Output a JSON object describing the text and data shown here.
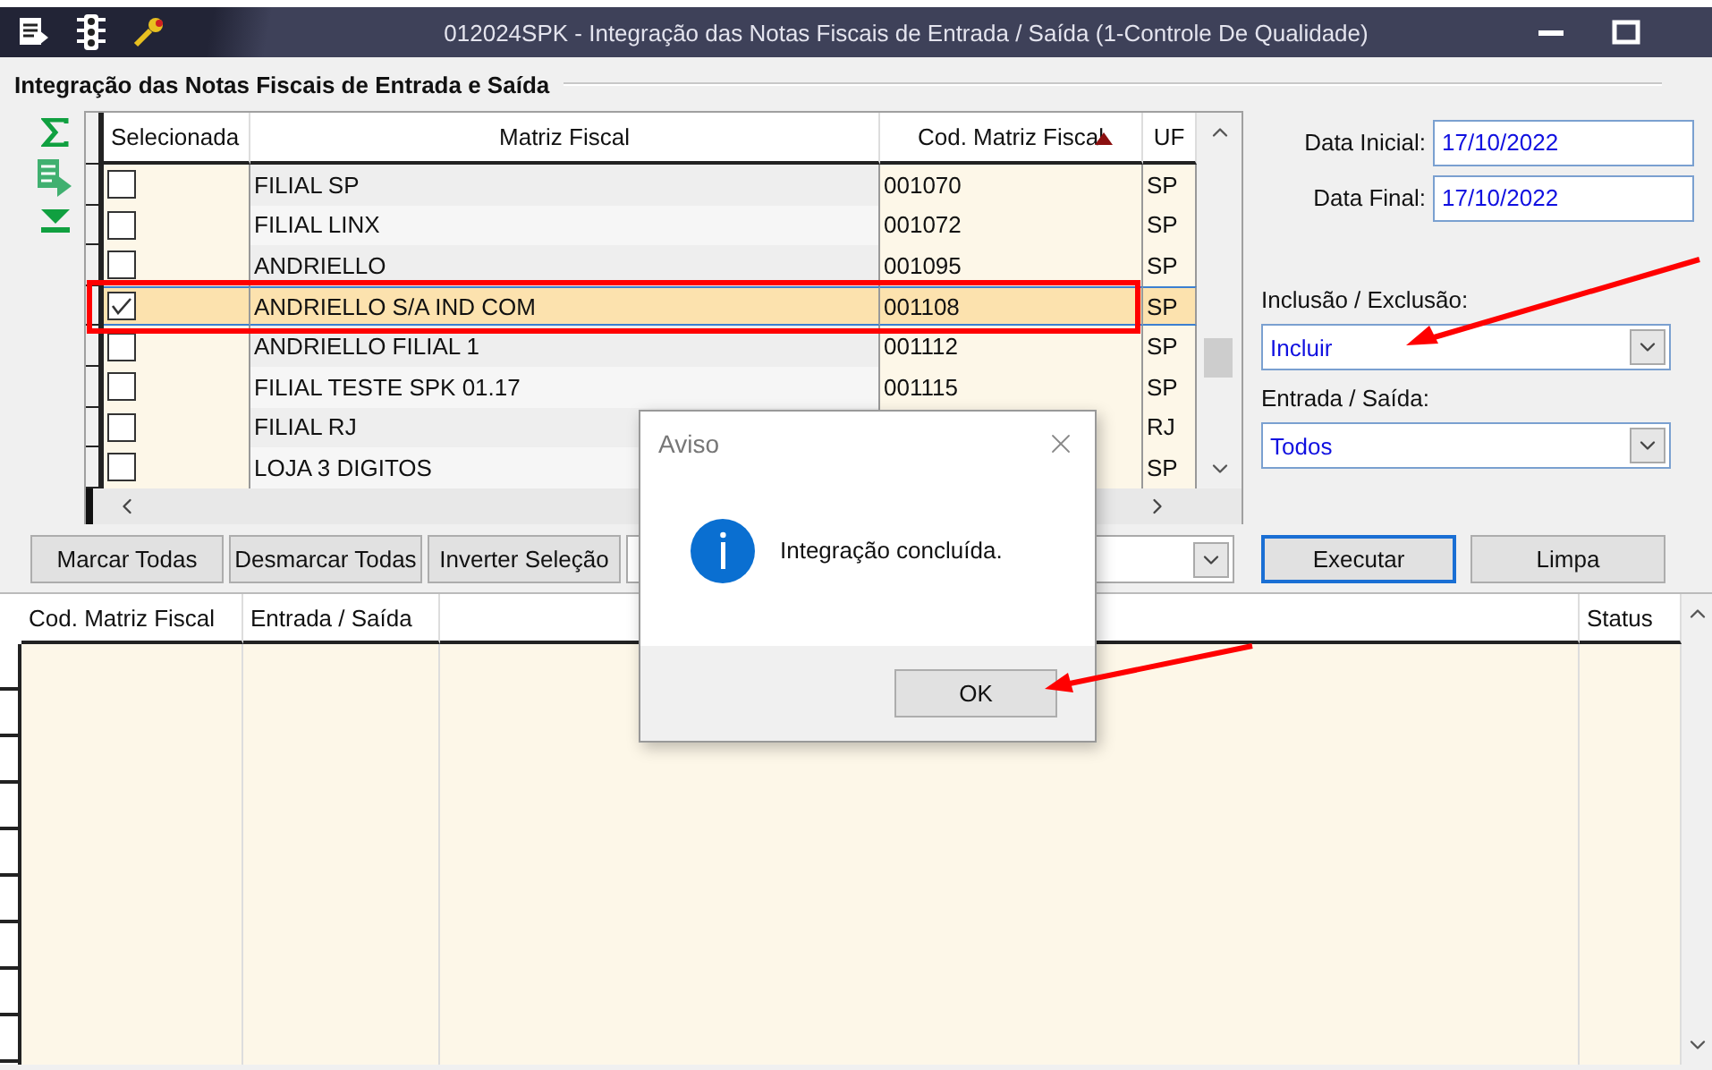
{
  "window": {
    "title": "012024SPK - Integração das Notas Fiscais de Entrada / Saída (1-Controle De Qualidade)"
  },
  "section_title": "Integração das Notas Fiscais de Entrada e Saída",
  "top_grid": {
    "columns": [
      {
        "label": "Selecionada",
        "sorted": false
      },
      {
        "label": "Matriz Fiscal",
        "sorted": false
      },
      {
        "label": "Cod. Matriz Fiscal",
        "sorted": true
      },
      {
        "label": "UF",
        "sorted": false
      }
    ],
    "rows": [
      {
        "selected": false,
        "checked": false,
        "matriz": "FILIAL SP",
        "cod": "001070",
        "uf": "SP"
      },
      {
        "selected": false,
        "checked": false,
        "matriz": "FILIAL LINX",
        "cod": "001072",
        "uf": "SP"
      },
      {
        "selected": false,
        "checked": false,
        "matriz": "ANDRIELLO",
        "cod": "001095",
        "uf": "SP"
      },
      {
        "selected": true,
        "checked": true,
        "matriz": "ANDRIELLO S/A IND COM",
        "cod": "001108",
        "uf": "SP"
      },
      {
        "selected": false,
        "checked": false,
        "matriz": "ANDRIELLO FILIAL 1",
        "cod": "001112",
        "uf": "SP"
      },
      {
        "selected": false,
        "checked": false,
        "matriz": "FILIAL TESTE SPK 01.17",
        "cod": "001115",
        "uf": "SP"
      },
      {
        "selected": false,
        "checked": false,
        "matriz": "FILIAL RJ",
        "uf": "RJ"
      },
      {
        "selected": false,
        "checked": false,
        "matriz": "LOJA 3 DIGITOS",
        "uf": "SP"
      }
    ]
  },
  "filters": {
    "date_start": {
      "label": "Data Inicial:",
      "value": "17/10/2022"
    },
    "date_end": {
      "label": "Data Final:",
      "value": "17/10/2022"
    },
    "inclusion": {
      "label": "Inclusão / Exclusão:",
      "value": "Incluir"
    },
    "direction": {
      "label": "Entrada / Saída:",
      "value": "Todos"
    }
  },
  "selection_buttons": [
    "Marcar Todas",
    "Desmarcar Todas",
    "Inverter Seleção"
  ],
  "actions": [
    {
      "label": "Executar",
      "default": true
    },
    {
      "label": "Limpa",
      "default": false
    }
  ],
  "bottom_grid": {
    "columns": [
      "Cod. Matriz Fiscal",
      "Entrada / Saída",
      "Status"
    ]
  },
  "dialog": {
    "title": "Aviso",
    "message": "Integração concluída.",
    "button": "OK"
  }
}
